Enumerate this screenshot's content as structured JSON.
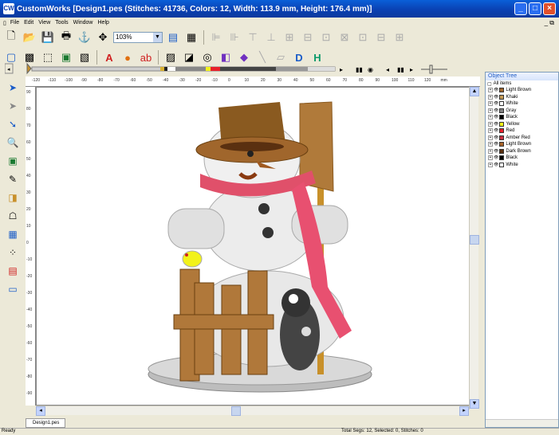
{
  "window": {
    "title": "CustomWorks  [Design1.pes (Stitches: 41736, Colors: 12, Width: 113.9 mm, Height: 176.4 mm)]",
    "app_icon": "CW"
  },
  "menu": [
    "File",
    "Edit",
    "View",
    "Tools",
    "Window",
    "Help"
  ],
  "toolbar": {
    "zoom": "103%"
  },
  "ruler": {
    "top": [
      "-120",
      "-110",
      "-100",
      "-90",
      "-80",
      "-70",
      "-60",
      "-50",
      "-40",
      "-30",
      "-20",
      "-10",
      "0",
      "10",
      "20",
      "30",
      "40",
      "50",
      "60",
      "70",
      "80",
      "90",
      "100",
      "110",
      "120",
      "mm"
    ],
    "left": [
      "90",
      "80",
      "70",
      "60",
      "50",
      "40",
      "30",
      "20",
      "10",
      "0",
      "-10",
      "-20",
      "-30",
      "-40",
      "-50",
      "-60",
      "-70",
      "-80",
      "-90"
    ]
  },
  "tree": {
    "title": "Object Tree",
    "root": "All items",
    "items": [
      {
        "label": "Light Brown",
        "color": "#a0662c"
      },
      {
        "label": "Khaki",
        "color": "#c49a55"
      },
      {
        "label": "White",
        "color": "#ffffff"
      },
      {
        "label": "Gray",
        "color": "#808080"
      },
      {
        "label": "Black",
        "color": "#000000"
      },
      {
        "label": "Yellow",
        "color": "#f2f21a"
      },
      {
        "label": "Red",
        "color": "#e8202a"
      },
      {
        "label": "Amber Red",
        "color": "#c83040"
      },
      {
        "label": "Light Brown",
        "color": "#a8642a"
      },
      {
        "label": "Dark Brown",
        "color": "#5a3010"
      },
      {
        "label": "Black",
        "color": "#000000"
      },
      {
        "label": "White",
        "color": "#ffffff"
      }
    ]
  },
  "doc_tab": "Design1.pes",
  "status": {
    "ready": "Ready",
    "info": "Total Segs: 12, Selected: 0, Stitches: 0"
  }
}
